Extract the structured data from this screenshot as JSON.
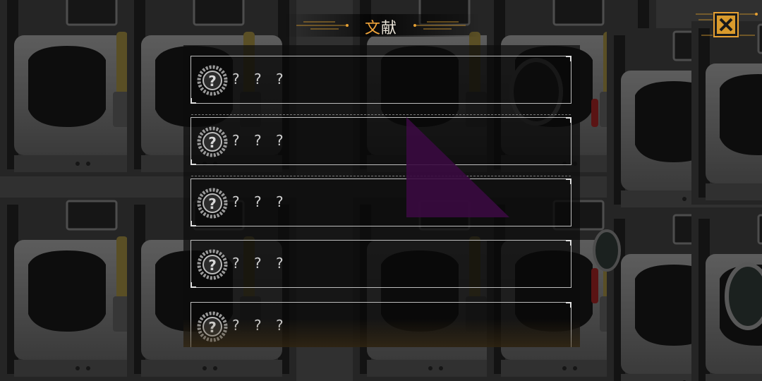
{
  "header": {
    "title_accent": "文",
    "title_rest": "献"
  },
  "close_button": {
    "icon": "close-x-icon",
    "accent_color": "#e6a033"
  },
  "documents": [
    {
      "name": "? ? ?",
      "locked": true,
      "icon": "unknown-badge-icon"
    },
    {
      "name": "? ? ?",
      "locked": true,
      "icon": "unknown-badge-icon"
    },
    {
      "name": "? ? ?",
      "locked": true,
      "icon": "unknown-badge-icon"
    },
    {
      "name": "? ? ?",
      "locked": true,
      "icon": "unknown-badge-icon"
    },
    {
      "name": "? ? ?",
      "locked": true,
      "icon": "unknown-badge-icon"
    }
  ],
  "colors": {
    "accent": "#f2a53a",
    "entry_border": "#bdbdbd",
    "overlay_artifact": "#3a0a40"
  }
}
